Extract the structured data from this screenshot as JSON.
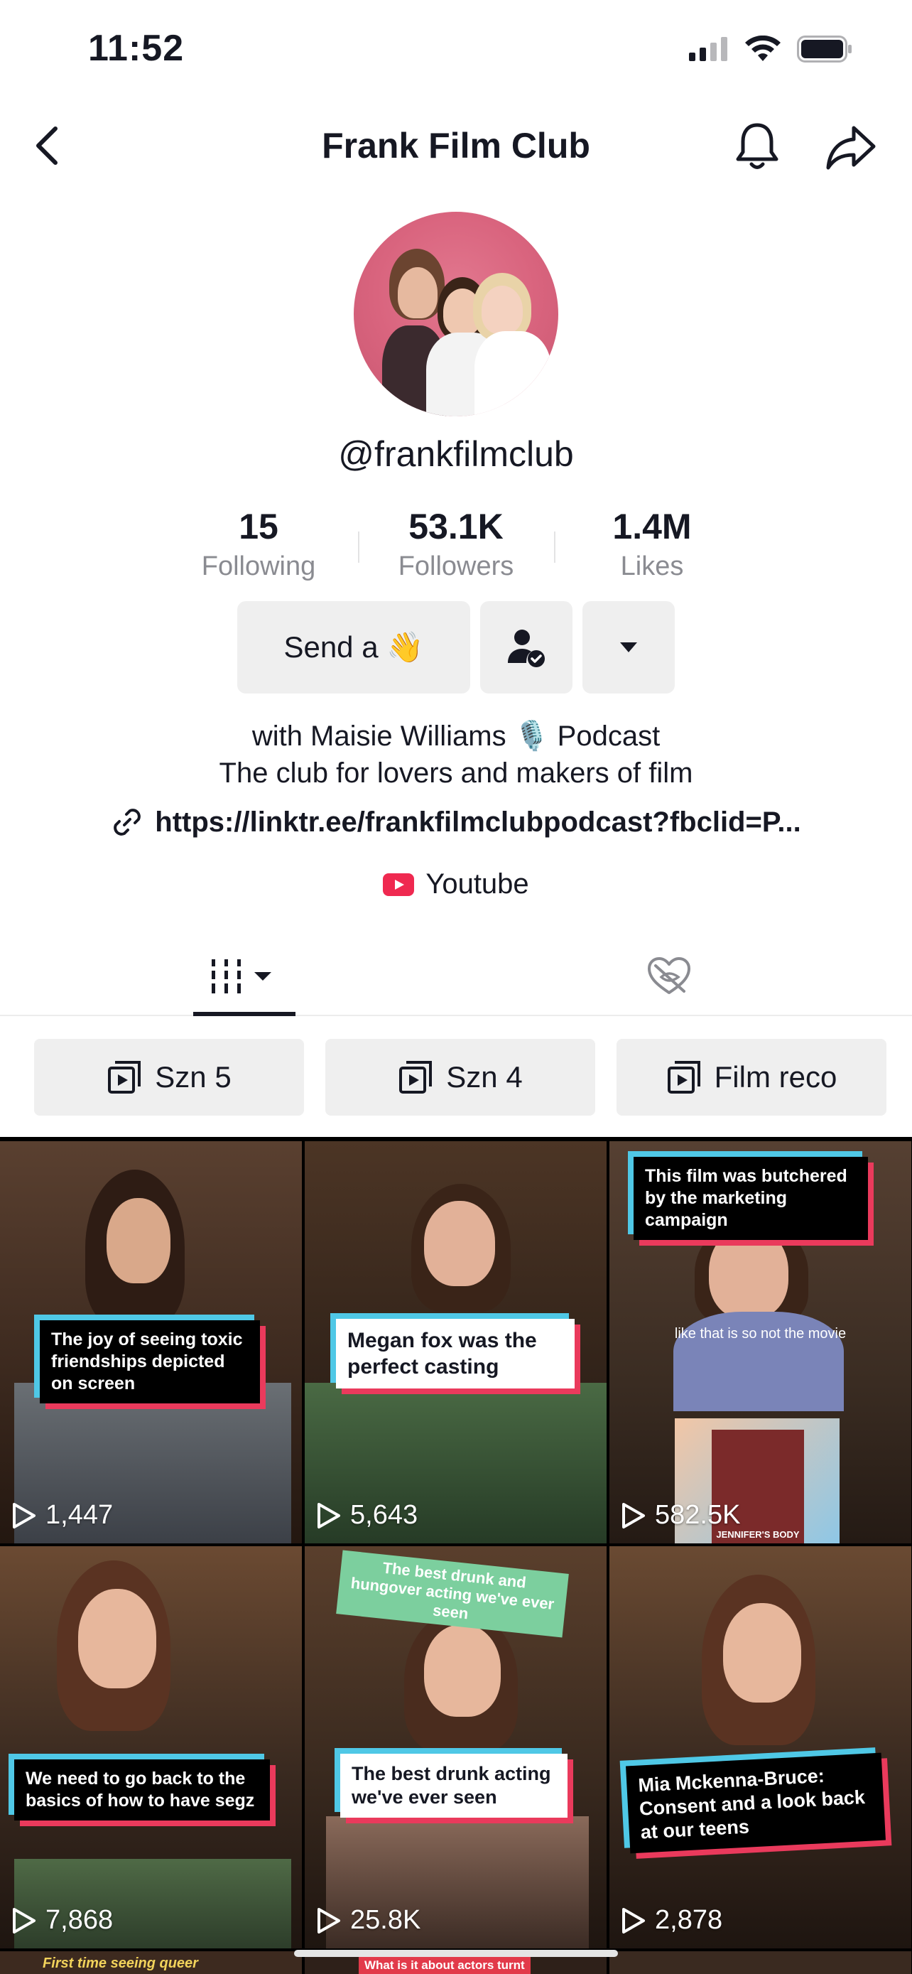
{
  "status": {
    "time": "11:52"
  },
  "nav": {
    "title": "Frank Film Club"
  },
  "profile": {
    "handle": "@frankfilmclub",
    "stats": [
      {
        "value": "15",
        "label": "Following"
      },
      {
        "value": "53.1K",
        "label": "Followers"
      },
      {
        "value": "1.4M",
        "label": "Likes"
      }
    ],
    "send_label": "Send a 👋",
    "bio_line1": "with Maisie Williams 🎙️ Podcast",
    "bio_line2": "The club for lovers and makers of film",
    "link": "https://linktr.ee/frankfilmclubpodcast?fbclid=P...",
    "youtube_label": "Youtube"
  },
  "playlists": [
    {
      "label": "Szn 5"
    },
    {
      "label": "Szn 4"
    },
    {
      "label": "Film reco"
    }
  ],
  "videos": [
    {
      "caption": "The joy of seeing toxic friendships depicted on screen",
      "views": "1,447"
    },
    {
      "caption": "Megan fox was the perfect casting",
      "views": "5,643"
    },
    {
      "caption": "This film was butchered by the marketing campaign",
      "subtitle": "like that is so not the movie",
      "poster_text": "JENNIFER'S BODY",
      "views": "582.5K"
    },
    {
      "caption": "We need to go back to the basics of how to have segz",
      "views": "7,868"
    },
    {
      "caption": "The best drunk acting we've ever seen",
      "top_caption": "The best drunk and hungover acting we've ever seen",
      "views": "25.8K"
    },
    {
      "caption": "Mia Mckenna-Bruce: Consent and a look back at our teens",
      "views": "2,878"
    },
    {
      "caption": "First time seeing queer",
      "views": ""
    },
    {
      "caption": "What is it about actors turnt",
      "views": ""
    }
  ],
  "colors": {
    "accent_red": "#ef2950",
    "caption_cyan": "#4fc8e6",
    "caption_pink": "#ea3a5c"
  }
}
